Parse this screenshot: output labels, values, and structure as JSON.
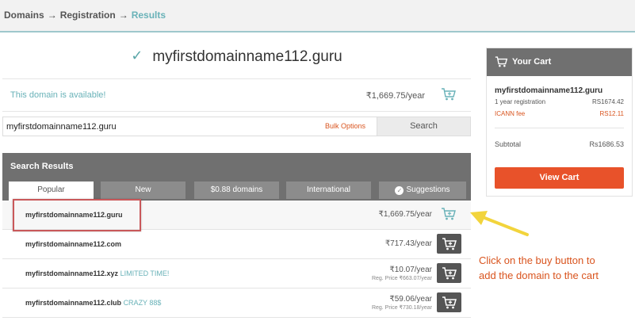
{
  "breadcrumb": {
    "step1": "Domains",
    "step2": "Registration",
    "step3": "Results",
    "separator": "→"
  },
  "domain_heading": "myfirstdomainname112.guru",
  "availability": {
    "message": "This domain is available!",
    "price": "₹1,669.75/year",
    "cart_icon": "cart-add-icon"
  },
  "search": {
    "value": "myfirstdomainname112.guru",
    "bulk_label": "Bulk Options",
    "button_label": "Search"
  },
  "results": {
    "title": "Search Results",
    "tabs": [
      {
        "label": "Popular",
        "active": true
      },
      {
        "label": "New",
        "active": false
      },
      {
        "label": "$0.88 domains",
        "active": false
      },
      {
        "label": "International",
        "active": false
      },
      {
        "label": "Suggestions",
        "active": false,
        "icon": "check-circle-icon"
      }
    ],
    "rows": [
      {
        "name": "myfirstdomainname112.guru",
        "promo": "",
        "price": "₹1,669.75/year",
        "reg_price": "",
        "in_cart": true
      },
      {
        "name": "myfirstdomainname112.com",
        "promo": "",
        "price": "₹717.43/year",
        "reg_price": "",
        "in_cart": false
      },
      {
        "name": "myfirstdomainname112.xyz",
        "promo": "LIMITED TIME!",
        "price": "₹10.07/year",
        "reg_price": "Reg. Price ₹663.07/year",
        "in_cart": false
      },
      {
        "name": "myfirstdomainname112.club",
        "promo": "CRAZY 88$",
        "price": "₹59.06/year",
        "reg_price": "Reg. Price ₹730.18/year",
        "in_cart": false
      }
    ]
  },
  "cart": {
    "title": "Your Cart",
    "icon": "cart-icon",
    "domain": "myfirstdomainname112.guru",
    "lines": [
      {
        "label": "1 year registration",
        "value": "RS1674.42",
        "color": "#555555"
      },
      {
        "label": "ICANN fee",
        "value": "RS12.11",
        "color": "#d9541e"
      }
    ],
    "subtotal_label": "Subtotal",
    "subtotal_value": "Rs1686.53",
    "button_label": "View Cart"
  },
  "annotation": {
    "text_line1": "Click on the buy button to",
    "text_line2": "add the domain to the cart",
    "color": "#d9541e",
    "arrow_color": "#f2d43c"
  },
  "colors": {
    "accent_teal": "#69b2b8",
    "buy_orange": "#e8522a",
    "header_gray": "#707070",
    "highlight_red": "#c9585a"
  }
}
